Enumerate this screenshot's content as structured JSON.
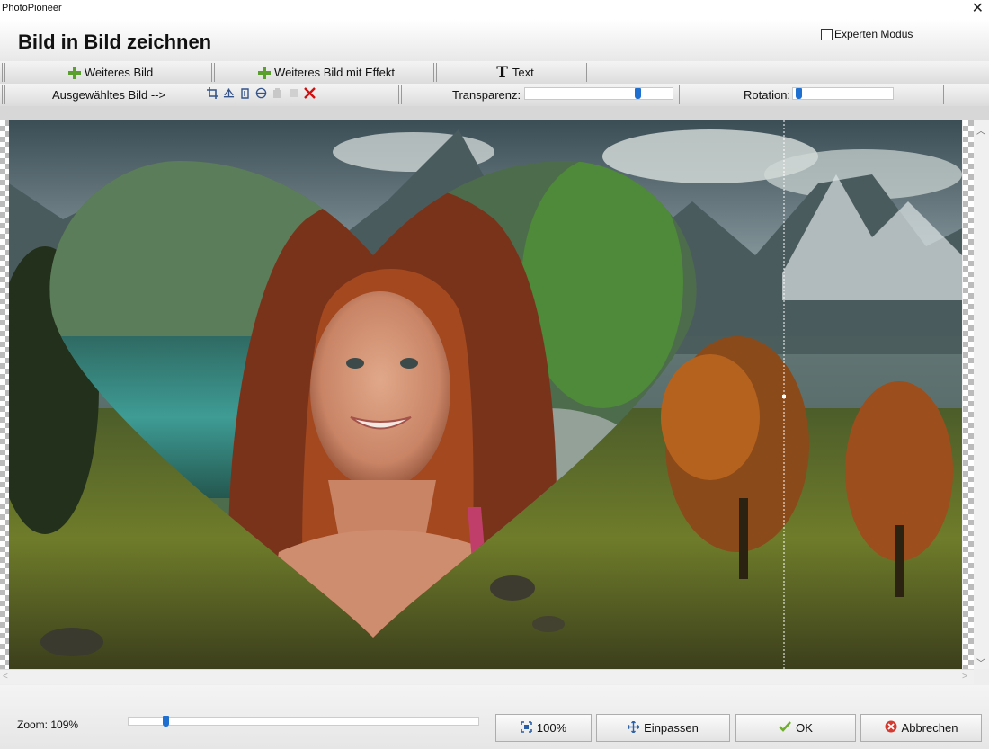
{
  "window": {
    "app_name": "PhotoPioneer",
    "close_glyph": "✕"
  },
  "header": {
    "title": "Bild in Bild zeichnen",
    "expert_mode_label": "Experten Modus",
    "expert_mode_checked": false
  },
  "toolbar_row1": {
    "add_image_label": "Weiteres Bild",
    "add_image_effect_label": "Weiteres Bild mit Effekt",
    "text_label": "Text"
  },
  "toolbar_row2": {
    "selected_image_label": "Ausgewähltes Bild -->",
    "icons": [
      "crop-icon",
      "flip-icon",
      "rotate-icon",
      "layer-icon",
      "copy-icon",
      "paste-icon",
      "delete-icon"
    ],
    "transparency_label": "Transparenz:",
    "transparency_value": 0.78,
    "rotation_label": "Rotation:",
    "rotation_value": 0.03
  },
  "colors": {
    "accent": "#1f6fd1",
    "add_green": "#5aa02c",
    "delete_red": "#d01010",
    "ok_green": "#6fae2d",
    "cancel_red": "#d43a2f"
  },
  "footer": {
    "zoom_label": "Zoom: 109%",
    "zoom_value": 0.1,
    "btn_100_label": "100%",
    "btn_fit_label": "Einpassen",
    "btn_ok_label": "OK",
    "btn_cancel_label": "Abbrechen"
  }
}
